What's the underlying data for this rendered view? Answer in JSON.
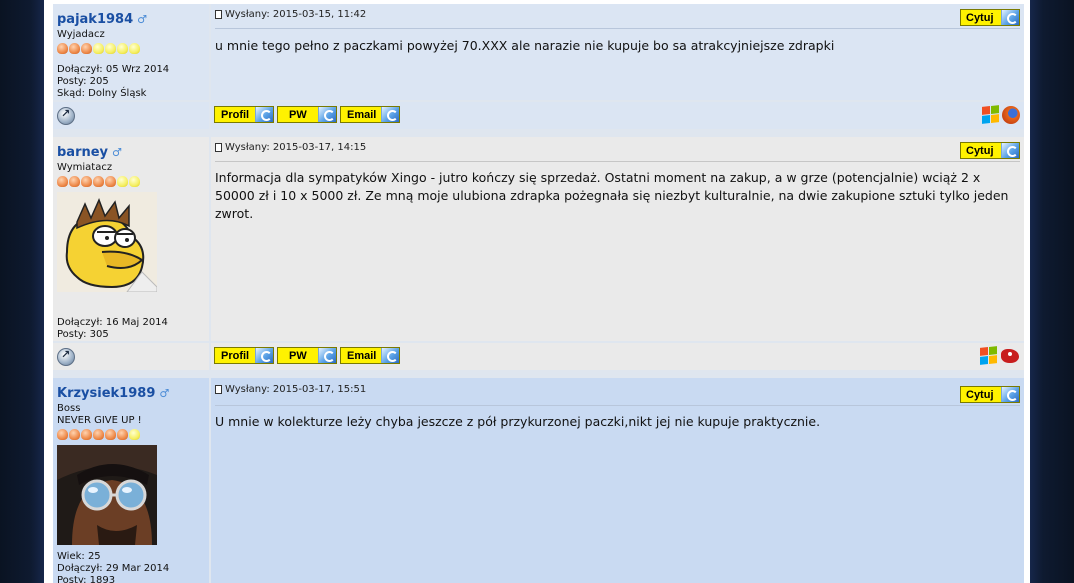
{
  "posts": [
    {
      "username": "pajak1984",
      "rank": "Wyjadacz",
      "stars_on": 3,
      "stars_total": 7,
      "joined": "Dołączył: 05 Wrz 2014",
      "posts": "Posty: 205",
      "from": "Skąd: Dolny Śląsk",
      "posted": "Wysłany: 2015-03-15, 11:42",
      "quote_label": "Cytuj",
      "body": "u mnie tego pełno z paczkami powyżej 70.XXX ale narazie nie kupuje bo sa atrakcyjniejsze zdrapki",
      "profile_label": "Profil",
      "pm_label": "PW",
      "email_label": "Email"
    },
    {
      "username": "barney",
      "rank": "Wymiatacz",
      "stars_on": 5,
      "stars_total": 7,
      "joined": "Dołączył: 16 Maj 2014",
      "posts": "Posty: 305",
      "posted": "Wysłany: 2015-03-17, 14:15",
      "quote_label": "Cytuj",
      "body": "Informacja dla sympatyków Xingo - jutro kończy się sprzedaż. Ostatni moment na zakup, a w grze (potencjalnie) wciąż 2 x 50000 zł i 10 x 5000 zł. Ze mną moje ulubiona zdrapka pożegnała się niezbyt kulturalnie, na dwie zakupione sztuki tylko jeden zwrot.",
      "profile_label": "Profil",
      "pm_label": "PW",
      "email_label": "Email"
    },
    {
      "username": "Krzysiek1989",
      "rank": "Boss",
      "rank2": "NEVER GIVE UP !",
      "stars_on": 6,
      "stars_total": 7,
      "age": "Wiek: 25",
      "joined": "Dołączył: 29 Mar 2014",
      "posts": "Posty: 1893",
      "posted": "Wysłany: 2015-03-17, 15:51",
      "quote_label": "Cytuj",
      "body": "U mnie w kolekturze leży chyba jeszcze z pół przykurzonej paczki,nikt jej nie kupuje praktycznie."
    }
  ]
}
